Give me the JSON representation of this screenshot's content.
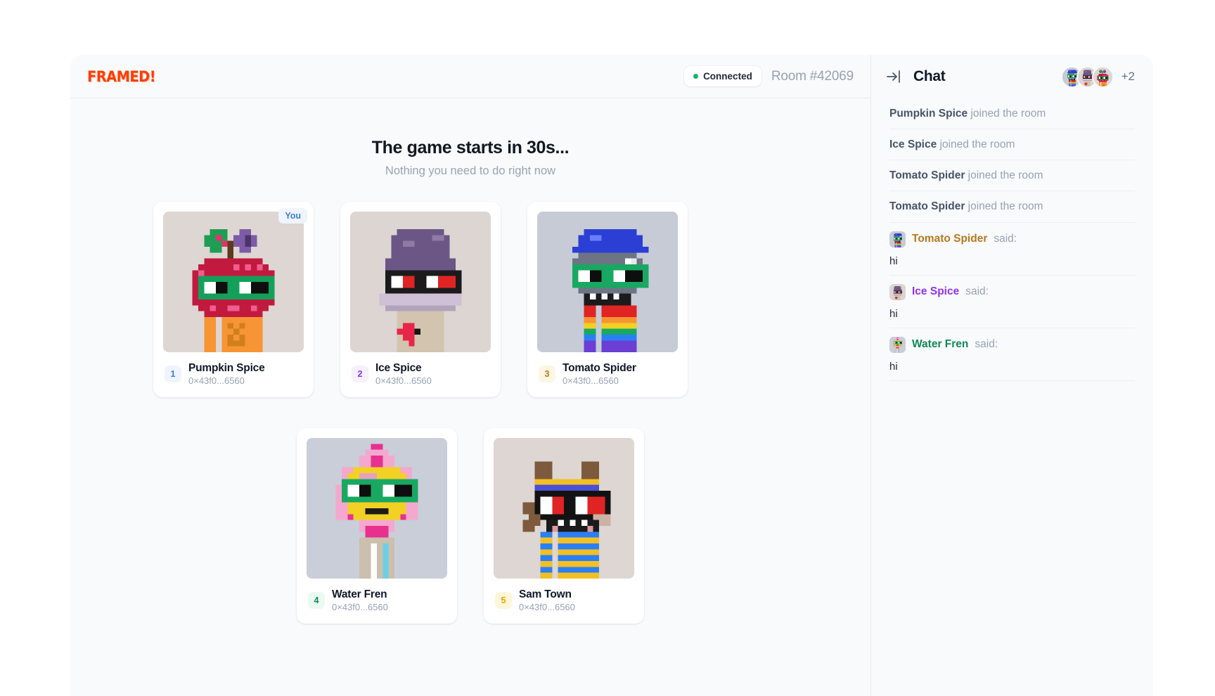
{
  "app": {
    "brand": "FRAMED!",
    "connection_status": "Connected",
    "connection_color": "#12b76a",
    "room_label": "Room #42069"
  },
  "game": {
    "status_title": "The game starts in 30s...",
    "status_subtitle": "Nothing you need to do right now",
    "you_badge": "You",
    "players": [
      {
        "rank": "1",
        "name": "Pumpkin Spice",
        "address": "0×43f0...6560",
        "is_you": true,
        "badge_color": "#3b7ddd",
        "badge_bg": "#eff4ff",
        "avatar": "pumpkin-spice",
        "frame_bg": "#ddd6d2"
      },
      {
        "rank": "2",
        "name": "Ice Spice",
        "address": "0×43f0...6560",
        "is_you": false,
        "badge_color": "#9333ea",
        "badge_bg": "#f6f1fe",
        "avatar": "ice-spice",
        "frame_bg": "#dcd5d1"
      },
      {
        "rank": "3",
        "name": "Tomato Spider",
        "address": "0×43f0...6560",
        "is_you": false,
        "badge_color": "#b7791f",
        "badge_bg": "#fdf6e3",
        "avatar": "tomato-spider",
        "frame_bg": "#c6cbd6"
      },
      {
        "rank": "4",
        "name": "Water Fren",
        "address": "0×43f0...6560",
        "is_you": false,
        "badge_color": "#12875b",
        "badge_bg": "#eafaf1",
        "avatar": "water-fren",
        "frame_bg": "#c9ced9"
      },
      {
        "rank": "5",
        "name": "Sam Town",
        "address": "0×43f0...6560",
        "is_you": false,
        "badge_color": "#e0a800",
        "badge_bg": "#fdf6d8",
        "avatar": "sam-town",
        "frame_bg": "#ddd6d2"
      }
    ]
  },
  "chat": {
    "title": "Chat",
    "collapse_icon": "collapse-right-icon",
    "overflow_count": "+2",
    "header_avatars": [
      "tomato-spider",
      "ice-spice",
      "pumpkin-spice"
    ],
    "messages": [
      {
        "type": "join",
        "name": "Pumpkin Spice",
        "suffix": " joined the room"
      },
      {
        "type": "join",
        "name": "Ice Spice",
        "suffix": " joined the room"
      },
      {
        "type": "join",
        "name": "Tomato Spider",
        "suffix": " joined the room"
      },
      {
        "type": "join",
        "name": "Tomato Spider",
        "suffix": " joined the room"
      },
      {
        "type": "said",
        "name": "Tomato Spider",
        "suffix": " said:",
        "body": "hi",
        "name_color": "#b7791f",
        "avatar": "tomato-spider"
      },
      {
        "type": "said",
        "name": "Ice Spice",
        "suffix": " said:",
        "body": "hi",
        "name_color": "#9333ea",
        "avatar": "ice-spice"
      },
      {
        "type": "said",
        "name": "Water Fren",
        "suffix": " said:",
        "body": "hi",
        "name_color": "#12875b",
        "avatar": "water-fren"
      }
    ]
  }
}
